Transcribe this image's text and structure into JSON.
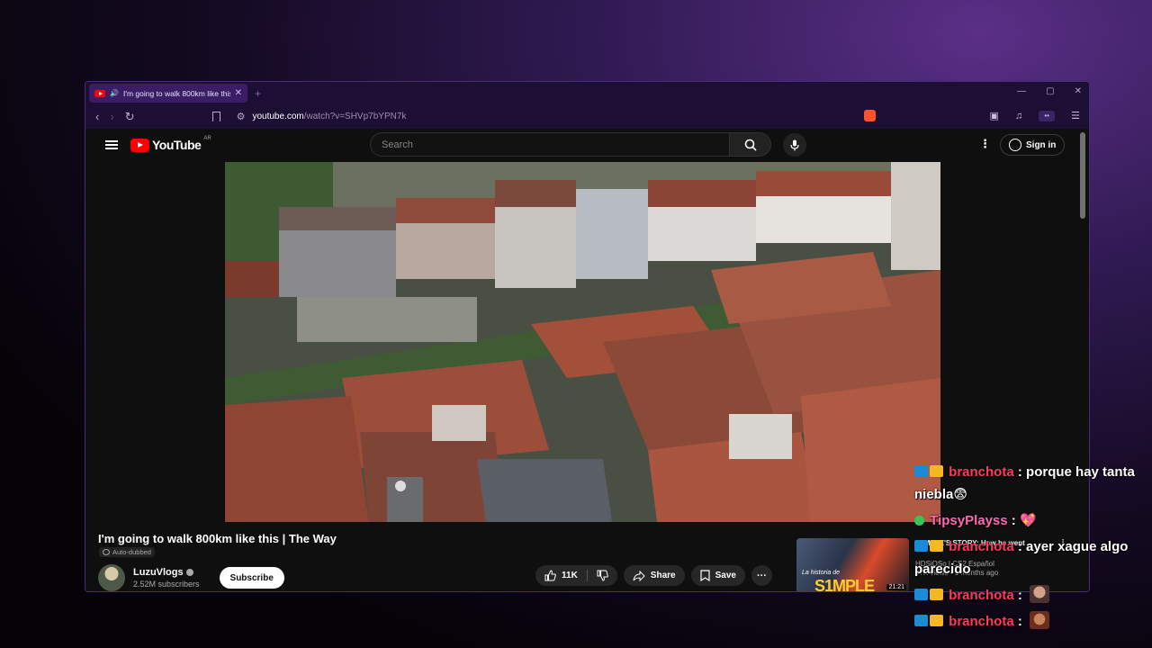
{
  "browser": {
    "tab": {
      "title": "I'm going to walk 800km like this | The Way",
      "close": "✕"
    },
    "new_tab": "+",
    "window_controls": {
      "minimize": "—",
      "maximize": "▢",
      "close": "✕"
    },
    "nav": {
      "back": "‹",
      "forward": "›",
      "reload": "↻"
    },
    "url": {
      "domain": "youtube.com",
      "path": "/watch?v=SHVp7bYPN7k"
    },
    "toolbar": {
      "playlist": "♫",
      "menu": "☰",
      "ext": "••"
    },
    "accent": "#3a1d66"
  },
  "youtube": {
    "logo_text": "YouTube",
    "country": "AR",
    "search_placeholder": "Search",
    "sign_in": "Sign in",
    "more": "⋮"
  },
  "video": {
    "title": "I'm going to walk 800km like this | The Way",
    "auto_dubbed": "Auto-dubbed",
    "channel": "LuzuVlogs",
    "subscribers": "2.52M subscribers",
    "subscribe_label": "Subscribe",
    "likes": "11K",
    "share_label": "Share",
    "save_label": "Save",
    "more": "···"
  },
  "related": {
    "title": "S1MPLE'S STORY: How he went",
    "channel": "HDSiOSo | CS2 Español",
    "meta": "97K views • 1 months ago",
    "duration": "21:21",
    "thumb_caption": "La historia de",
    "thumb_big": "S1MPLE"
  },
  "chat": [
    {
      "user": "branchota",
      "color": "#ff3a5c",
      "sep": " : ",
      "text": "porque hay tanta niebla😨",
      "badges": [
        "prime",
        "crown"
      ]
    },
    {
      "user": "TipsyPlayss",
      "color": "#ff69b4",
      "sep": " : ",
      "text": "💖",
      "badges": [
        "check"
      ]
    },
    {
      "user": "branchota",
      "color": "#ff3a5c",
      "sep": " : ",
      "text": "ayer xague algo parecido",
      "badges": [
        "prime",
        "crown"
      ]
    },
    {
      "user": "branchota",
      "color": "#ff3a5c",
      "sep": " : ",
      "text": "",
      "badges": [
        "prime",
        "crown"
      ],
      "emote": "face1"
    },
    {
      "user": "branchota",
      "color": "#ff3a5c",
      "sep": " : ",
      "text": "",
      "badges": [
        "prime",
        "crown"
      ],
      "emote": "face2"
    }
  ]
}
